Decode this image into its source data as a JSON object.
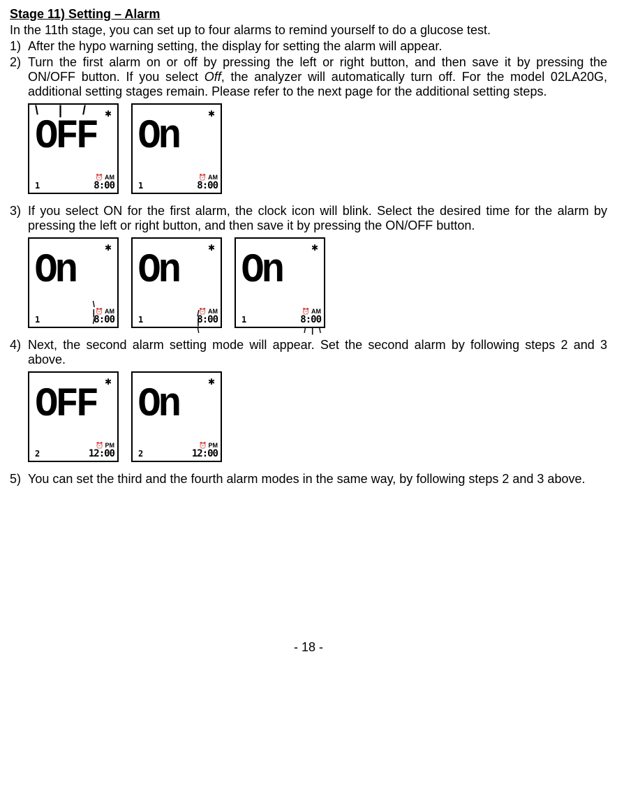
{
  "heading": "Stage 11) Setting – Alarm",
  "intro": "In the 11th stage, you can set up to four alarms to remind yourself to do a glucose test.",
  "items": {
    "1": {
      "num": "1)",
      "text": "After the hypo warning setting, the display for setting the alarm will appear."
    },
    "2": {
      "num": "2)",
      "text_a": "Turn the first alarm on or off by pressing the left or right button, and then save it by pressing the ON/OFF button. If you select ",
      "text_off": "Off",
      "text_b": ", the analyzer will automatically turn off. For the model 02LA20G, additional setting stages remain. Please refer to the next page for the additional setting steps."
    },
    "3": {
      "num": "3)",
      "text": "If you select ON for the first alarm, the clock icon will blink. Select the desired time for the alarm by pressing the left or right button, and then save it by pressing the ON/OFF button."
    },
    "4": {
      "num": "4)",
      "text": "Next, the second alarm setting mode will appear. Set the second alarm by following steps 2 and 3 above."
    },
    "5": {
      "num": "5)",
      "text": "You can set the third and the fourth alarm modes in the same way, by following steps 2 and 3 above."
    }
  },
  "lcd": {
    "row1": [
      {
        "big": "OFF",
        "slot": "1",
        "ampm": "AM",
        "time": "8:00",
        "blinktop": "\\ | /"
      },
      {
        "big": "On",
        "slot": "1",
        "ampm": "AM",
        "time": "8:00"
      }
    ],
    "row2": [
      {
        "big": "On",
        "slot": "1",
        "ampm": "AM",
        "time": "8:00",
        "mark_clock": true
      },
      {
        "big": "On",
        "slot": "1",
        "ampm": "AM",
        "time": "8:00",
        "mark_hour": true
      },
      {
        "big": "On",
        "slot": "1",
        "ampm": "AM",
        "time": "8:00",
        "mark_min": true
      }
    ],
    "row3": [
      {
        "big": "OFF",
        "slot": "2",
        "ampm": "PM",
        "time": "12:00"
      },
      {
        "big": "On",
        "slot": "2",
        "ampm": "PM",
        "time": "12:00"
      }
    ]
  },
  "footer": "- 18 -"
}
